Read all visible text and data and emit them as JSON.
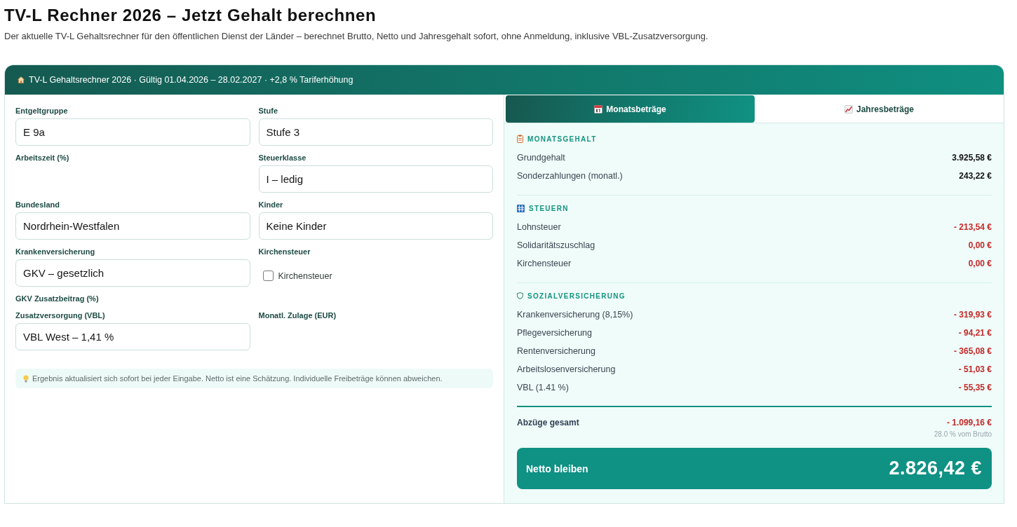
{
  "page": {
    "title": "TV-L Rechner 2026 – Jetzt Gehalt berechnen",
    "subtitle": "Der aktuelle TV-L Gehaltsrechner für den öffentlichen Dienst der Länder – berechnet Brutto, Netto und Jahresgehalt sofort, ohne Anmeldung, inklusive VBL-Zusatzversorgung."
  },
  "calculator": {
    "header": "TV-L Gehaltsrechner 2026 · Gültig 01.04.2026 – 28.02.2027 · +2,8 % Tariferhöhung",
    "form": {
      "rows": [
        [
          {
            "kind": "select",
            "label": "Entgeltgruppe",
            "value": "E 9a"
          },
          {
            "kind": "select",
            "label": "Stufe",
            "value": "Stufe 3"
          }
        ],
        [
          {
            "kind": "empty",
            "label": "Arbeitszeit (%)"
          },
          {
            "kind": "select",
            "label": "Steuerklasse",
            "value": "I – ledig"
          }
        ],
        [
          {
            "kind": "select",
            "label": "Bundesland",
            "value": "Nordrhein-Westfalen"
          },
          {
            "kind": "select",
            "label": "Kinder",
            "value": "Keine Kinder"
          }
        ],
        [
          {
            "kind": "select",
            "label": "Krankenversicherung",
            "value": "GKV – gesetzlich"
          },
          {
            "kind": "checkbox",
            "label": "Kirchensteuer",
            "option": "Kirchensteuer",
            "checked": false
          }
        ],
        [
          {
            "kind": "empty",
            "label": "GKV Zusatzbeitrag (%)"
          }
        ],
        [
          {
            "kind": "select",
            "label": "Zusatzversorgung (VBL)",
            "value": "VBL West – 1,41 %"
          },
          {
            "kind": "empty",
            "label": "Monatl. Zulage (EUR)"
          }
        ]
      ],
      "hint": "Ergebnis aktualisiert sich sofort bei jeder Eingabe. Netto ist eine Schätzung. Individuelle Freibeträge können abweichen."
    },
    "results": {
      "tabs": [
        {
          "label": "Monatsbeträge",
          "selected": true
        },
        {
          "label": "Jahresbeträge",
          "selected": false
        }
      ],
      "sections": [
        {
          "title": "MONATSGEHALT",
          "rows": [
            {
              "kind": "credit",
              "label": "Grundgehalt",
              "value": "3.925,58 €"
            },
            {
              "kind": "credit",
              "label": "Sonderzahlungen (monatl.)",
              "value": "243,22 €"
            }
          ]
        },
        {
          "title": "STEUERN",
          "rows": [
            {
              "kind": "deduction",
              "label": "Lohnsteuer",
              "value": "- 213,54 €"
            },
            {
              "kind": "deduction",
              "label": "Solidaritätszuschlag",
              "value": "0,00 €"
            },
            {
              "kind": "deduction",
              "label": "Kirchensteuer",
              "value": "0,00 €"
            }
          ]
        },
        {
          "title": "SOZIALVERSICHERUNG",
          "rows": [
            {
              "kind": "deduction",
              "label": "Krankenversicherung (8,15%)",
              "value": "- 319,93 €"
            },
            {
              "kind": "deduction",
              "label": "Pflegeversicherung",
              "value": "- 94,21 €"
            },
            {
              "kind": "deduction",
              "label": "Rentenversicherung",
              "value": "- 365,08 €"
            },
            {
              "kind": "deduction",
              "label": "Arbeitslosenversicherung",
              "value": "- 51,03 €"
            },
            {
              "kind": "deduction",
              "label": "VBL (1.41 %)",
              "value": "- 55,35 €"
            }
          ]
        }
      ],
      "total": {
        "label": "Abzüge gesamt",
        "value": "- 1.099,16 €",
        "note": "28.0 % vom Brutto"
      },
      "net": {
        "label": "Netto bleiben",
        "value": "2.826,42 €"
      }
    }
  }
}
